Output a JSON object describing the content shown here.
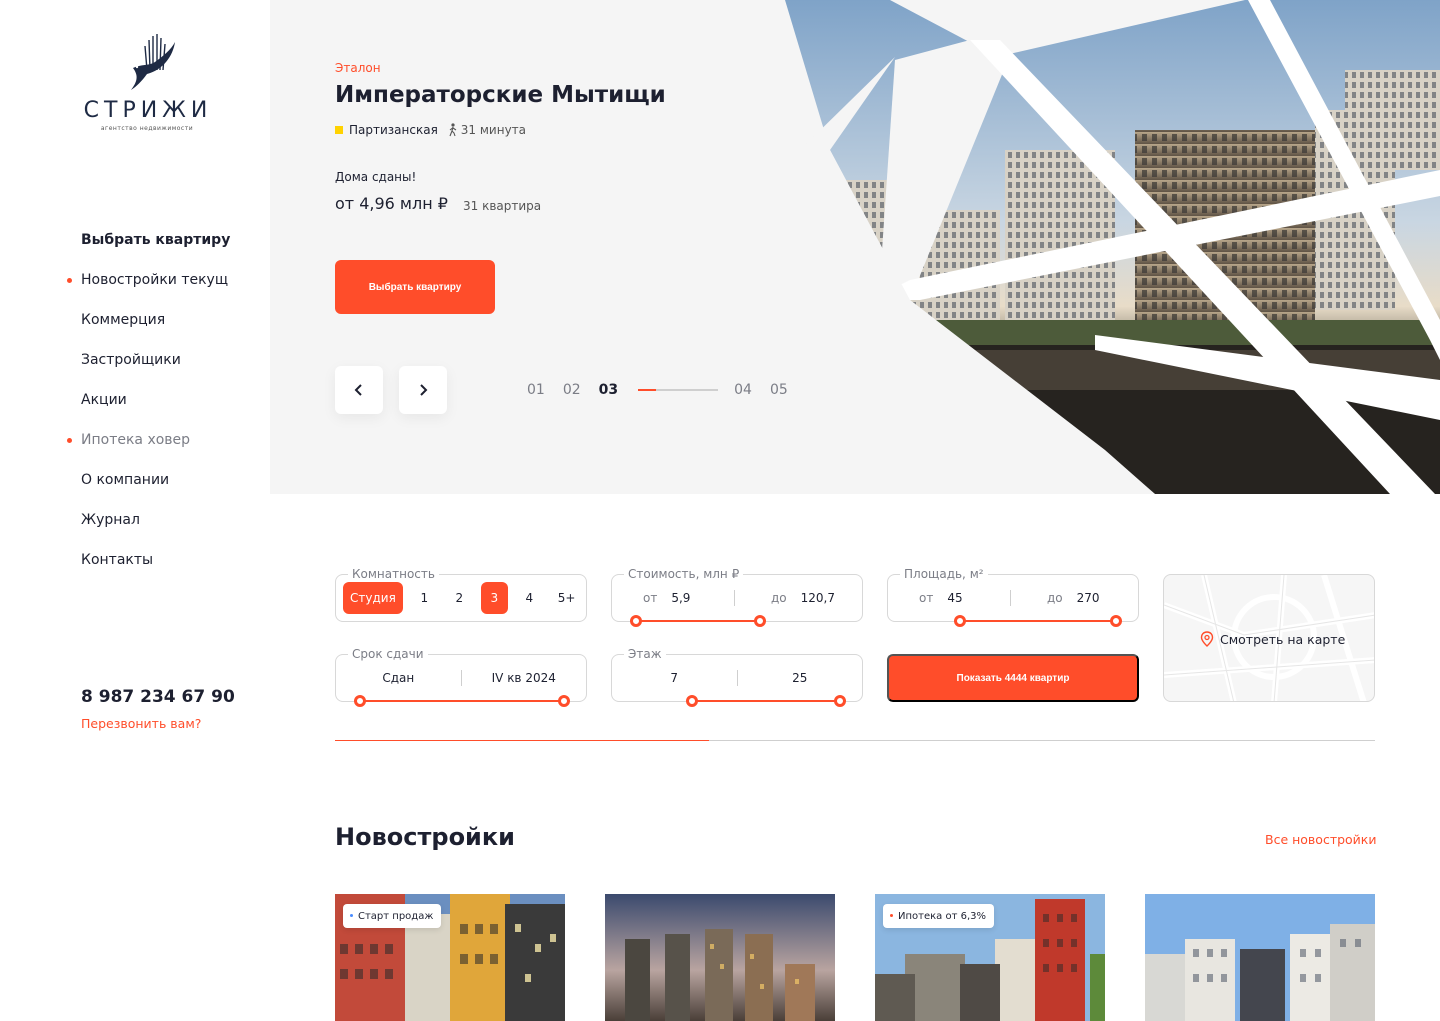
{
  "logo": {
    "name": "СТРИЖИ",
    "tagline": "агентство недвижимости"
  },
  "nav": [
    {
      "label": "Выбрать квартиру",
      "state": "active"
    },
    {
      "label": "Новостройки текущ",
      "state": "dot"
    },
    {
      "label": "Коммерция",
      "state": ""
    },
    {
      "label": "Застройщики",
      "state": ""
    },
    {
      "label": "Акции",
      "state": ""
    },
    {
      "label": "Ипотека ховер",
      "state": "dot-muted"
    },
    {
      "label": "О компании",
      "state": ""
    },
    {
      "label": "Журнал",
      "state": ""
    },
    {
      "label": "Контакты",
      "state": ""
    }
  ],
  "contact": {
    "phone": "8 987 234 67 90",
    "callback": "Перезвонить вам?"
  },
  "hero": {
    "brand": "Эталон",
    "title": "Императорские Мытищи",
    "metro": "Партизанская",
    "walk": "31 минута",
    "status": "Дома сданы!",
    "price": "от 4,96 млн ₽",
    "apartments": "31 квартира",
    "cta": "Выбрать квартиру",
    "slides": [
      "01",
      "02",
      "03",
      "04",
      "05"
    ],
    "current_slide": "03",
    "slide_progress": 0.22
  },
  "filters": {
    "rooms": {
      "label": "Комнатность",
      "options": [
        "Студия",
        "1",
        "2",
        "3",
        "4",
        "5+"
      ],
      "selected": [
        "Студия",
        "3"
      ]
    },
    "price": {
      "label": "Стоимость, млн ₽",
      "from_label": "от",
      "from": "5,9",
      "to_label": "до",
      "to": "120,7"
    },
    "area": {
      "label": "Площадь, м²",
      "from_label": "от",
      "from": "45",
      "to_label": "до",
      "to": "270"
    },
    "deadline": {
      "label": "Срок сдачи",
      "from": "Сдан",
      "to": "IV кв 2024"
    },
    "floor": {
      "label": "Этаж",
      "from": "7",
      "to": "25"
    },
    "show_button": "Показать 4444 квартир",
    "map_button": "Смотреть на карте",
    "progress": 0.36
  },
  "listing": {
    "title": "Новостройки",
    "all_link": "Все новостройки",
    "cards": [
      {
        "badge": "Старт продаж"
      },
      {
        "badge": ""
      },
      {
        "badge": "Ипотека от 6,3%"
      },
      {
        "badge": ""
      }
    ]
  },
  "colors": {
    "accent": "#ff4d2a",
    "metro_line": "#ffd200",
    "text": "#1d2030",
    "muted": "#7b7d86"
  }
}
